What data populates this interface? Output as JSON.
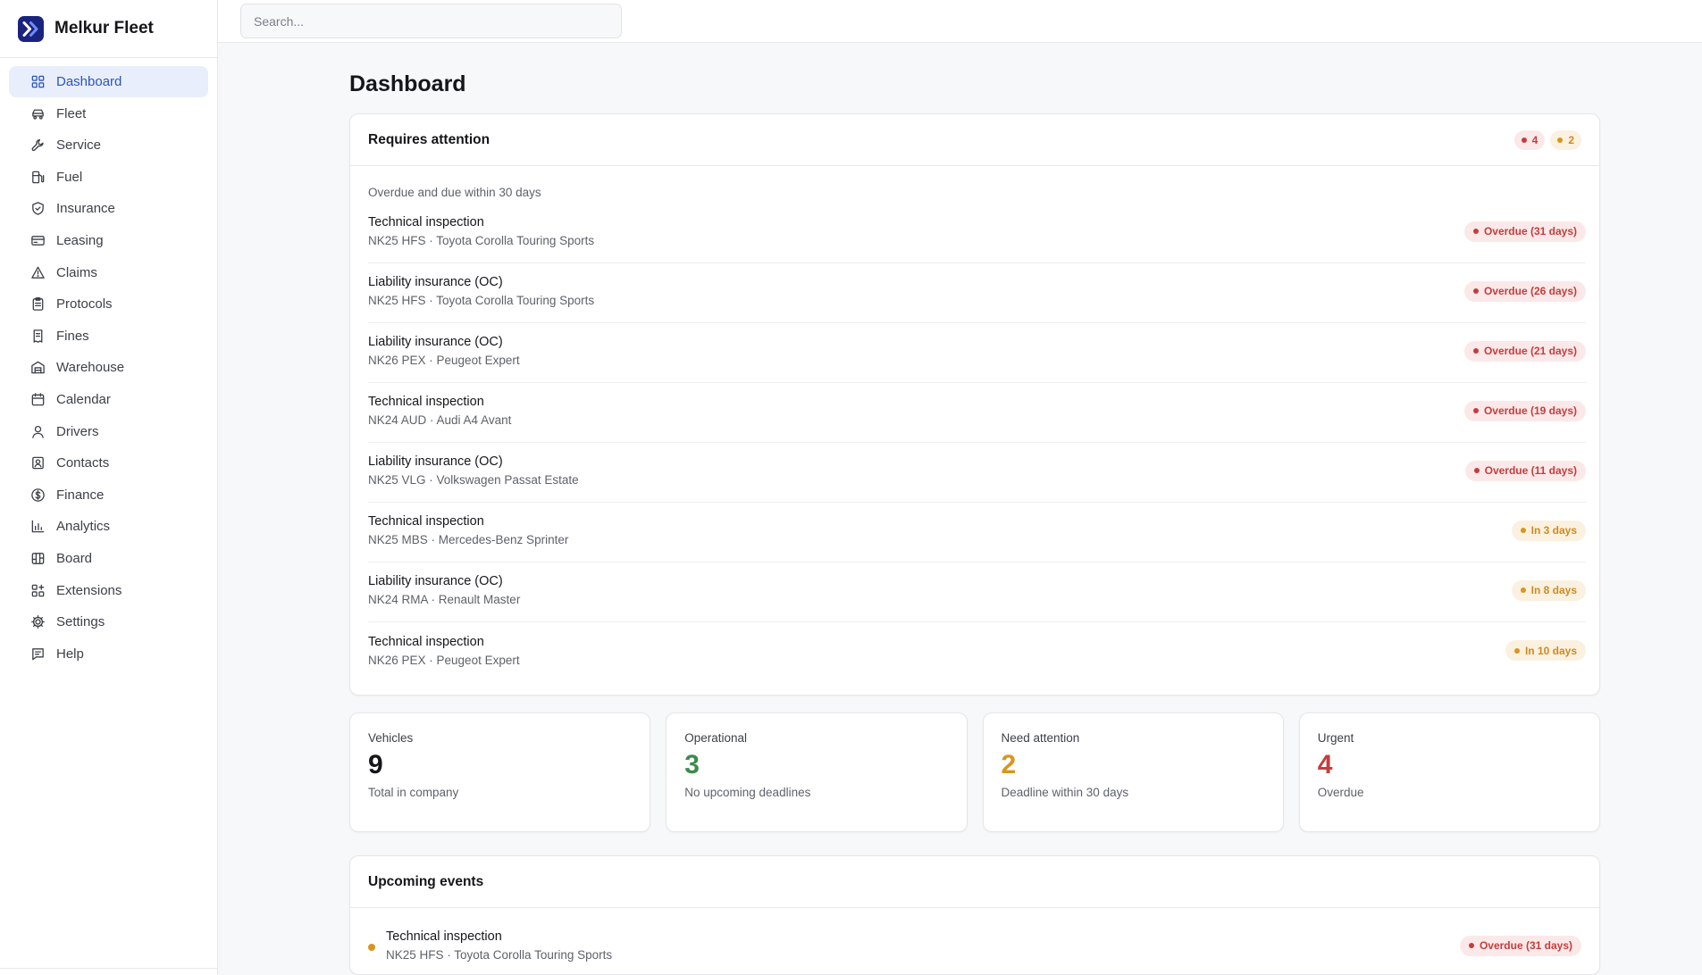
{
  "app": {
    "name": "Melkur Fleet"
  },
  "search": {
    "placeholder": "Search..."
  },
  "nav": [
    {
      "label": "Dashboard",
      "icon": "grid-icon",
      "active": true
    },
    {
      "label": "Fleet",
      "icon": "car-icon"
    },
    {
      "label": "Service",
      "icon": "wrench-icon"
    },
    {
      "label": "Fuel",
      "icon": "fuel-pump-icon"
    },
    {
      "label": "Insurance",
      "icon": "shield-icon"
    },
    {
      "label": "Leasing",
      "icon": "credit-card-icon"
    },
    {
      "label": "Claims",
      "icon": "warning-triangle-icon"
    },
    {
      "label": "Protocols",
      "icon": "clipboard-icon"
    },
    {
      "label": "Fines",
      "icon": "receipt-icon"
    },
    {
      "label": "Warehouse",
      "icon": "warehouse-icon"
    },
    {
      "label": "Calendar",
      "icon": "calendar-icon"
    },
    {
      "label": "Drivers",
      "icon": "user-icon"
    },
    {
      "label": "Contacts",
      "icon": "contact-card-icon"
    },
    {
      "label": "Finance",
      "icon": "dollar-circle-icon"
    },
    {
      "label": "Analytics",
      "icon": "bar-chart-icon"
    },
    {
      "label": "Board",
      "icon": "kanban-icon"
    },
    {
      "label": "Extensions",
      "icon": "puzzle-grid-icon"
    },
    {
      "label": "Settings",
      "icon": "gear-icon"
    },
    {
      "label": "Help",
      "icon": "message-square-icon"
    }
  ],
  "page": {
    "title": "Dashboard"
  },
  "attention": {
    "title": "Requires attention",
    "badge_red": "4",
    "badge_amber": "2",
    "subtitle": "Overdue and due within 30 days",
    "items": [
      {
        "title": "Technical inspection",
        "sub": "NK25 HFS · Toyota Corolla Touring Sports",
        "status": "Overdue (31 days)",
        "level": "red"
      },
      {
        "title": "Liability insurance (OC)",
        "sub": "NK25 HFS · Toyota Corolla Touring Sports",
        "status": "Overdue (26 days)",
        "level": "red"
      },
      {
        "title": "Liability insurance (OC)",
        "sub": "NK26 PEX · Peugeot Expert",
        "status": "Overdue (21 days)",
        "level": "red"
      },
      {
        "title": "Technical inspection",
        "sub": "NK24 AUD · Audi A4 Avant",
        "status": "Overdue (19 days)",
        "level": "red"
      },
      {
        "title": "Liability insurance (OC)",
        "sub": "NK25 VLG · Volkswagen Passat Estate",
        "status": "Overdue (11 days)",
        "level": "red"
      },
      {
        "title": "Technical inspection",
        "sub": "NK25 MBS · Mercedes-Benz Sprinter",
        "status": "In 3 days",
        "level": "amber"
      },
      {
        "title": "Liability insurance (OC)",
        "sub": "NK24 RMA · Renault Master",
        "status": "In 8 days",
        "level": "amber"
      },
      {
        "title": "Technical inspection",
        "sub": "NK26 PEX · Peugeot Expert",
        "status": "In 10 days",
        "level": "amber"
      }
    ]
  },
  "stats": [
    {
      "label": "Vehicles",
      "value": "9",
      "sub": "Total in company",
      "color": "#14161a"
    },
    {
      "label": "Operational",
      "value": "3",
      "sub": "No upcoming deadlines",
      "color": "#3c8a4f"
    },
    {
      "label": "Need attention",
      "value": "2",
      "sub": "Deadline within 30 days",
      "color": "#d8961f"
    },
    {
      "label": "Urgent",
      "value": "4",
      "sub": "Overdue",
      "color": "#c43d3d"
    }
  ],
  "events": {
    "title": "Upcoming events",
    "items": [
      {
        "title": "Technical inspection",
        "sub": "NK25 HFS · Toyota Corolla Touring Sports",
        "status": "Overdue (31 days)",
        "level": "red"
      }
    ]
  },
  "colors": {
    "accent": "#2b55b8",
    "danger": "#c43d3d",
    "warning": "#d8961f",
    "success": "#3c8a4f"
  }
}
